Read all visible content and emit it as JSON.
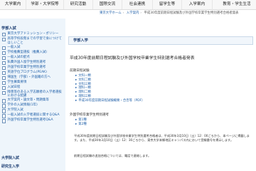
{
  "nav": {
    "items": [
      "大学案内",
      "学部・大学院等",
      "研究活動",
      "国際交流",
      "社会連携",
      "留学生等",
      "入学案内",
      "教育・学生生活"
    ]
  },
  "breadcrumb": [
    "東京大学ホーム",
    "入学案内",
    "平成30年度前期日程試験及び外国学校卒業学生特別選考合格者発表"
  ],
  "sidebar": {
    "heading": "学部入試",
    "items": [
      "東京大学アドミッション・ポリシー",
      "高等学校段階までの学習で身につけてほしいこと",
      "一般入試",
      "学校推薦型選抜（推薦入試）",
      "一般入試の配点",
      "私費外国人留学生特別選考",
      "外国学校卒業学生特別選考",
      "英語学位プログラム(PEAK)",
      "帰国生（学部）・外国籍の方へ",
      "学生募集要項",
      "入試日程",
      "障害等のある入学志願者の入学者選抜における配慮",
      "大学案内・論文等・問題集等",
      "学外の入試情報(1年)",
      "大学院入試",
      "一般入試の入学者選抜に関するQ&A",
      "外国学校卒業学生特別選考Q&A"
    ],
    "foot_items": [
      "大学院入試",
      "研究生入学"
    ]
  },
  "main": {
    "section_title": "学部入学",
    "page_title": "平成30年度前期日程試験及び外国学校卒業学生特別選考合格者発表",
    "group1_title": "前期日程試験",
    "group1_links": [
      "文科一類",
      "文科二類",
      "文科三類",
      "理科一類",
      "理科二類",
      "理科三類",
      "平成30年度前期日程試験概要・合否等（PDF）"
    ],
    "group2_title": "外国学校卒業学生特別選考",
    "group2_links": [
      "第1種",
      "第2種"
    ],
    "para1": "平成30年度前期日程試験及び外国学校卒業学生特別選考合格者は、平成30年3月10日（土）12：00ごろから、本ページに掲載します。また、平成30年3月10日（土）12：30ごろから、東京大学本郷地区キャンパス内において受験番号を掲示します。",
    "para2": "前期日程試験の追加合格については、電話で連絡します。"
  }
}
